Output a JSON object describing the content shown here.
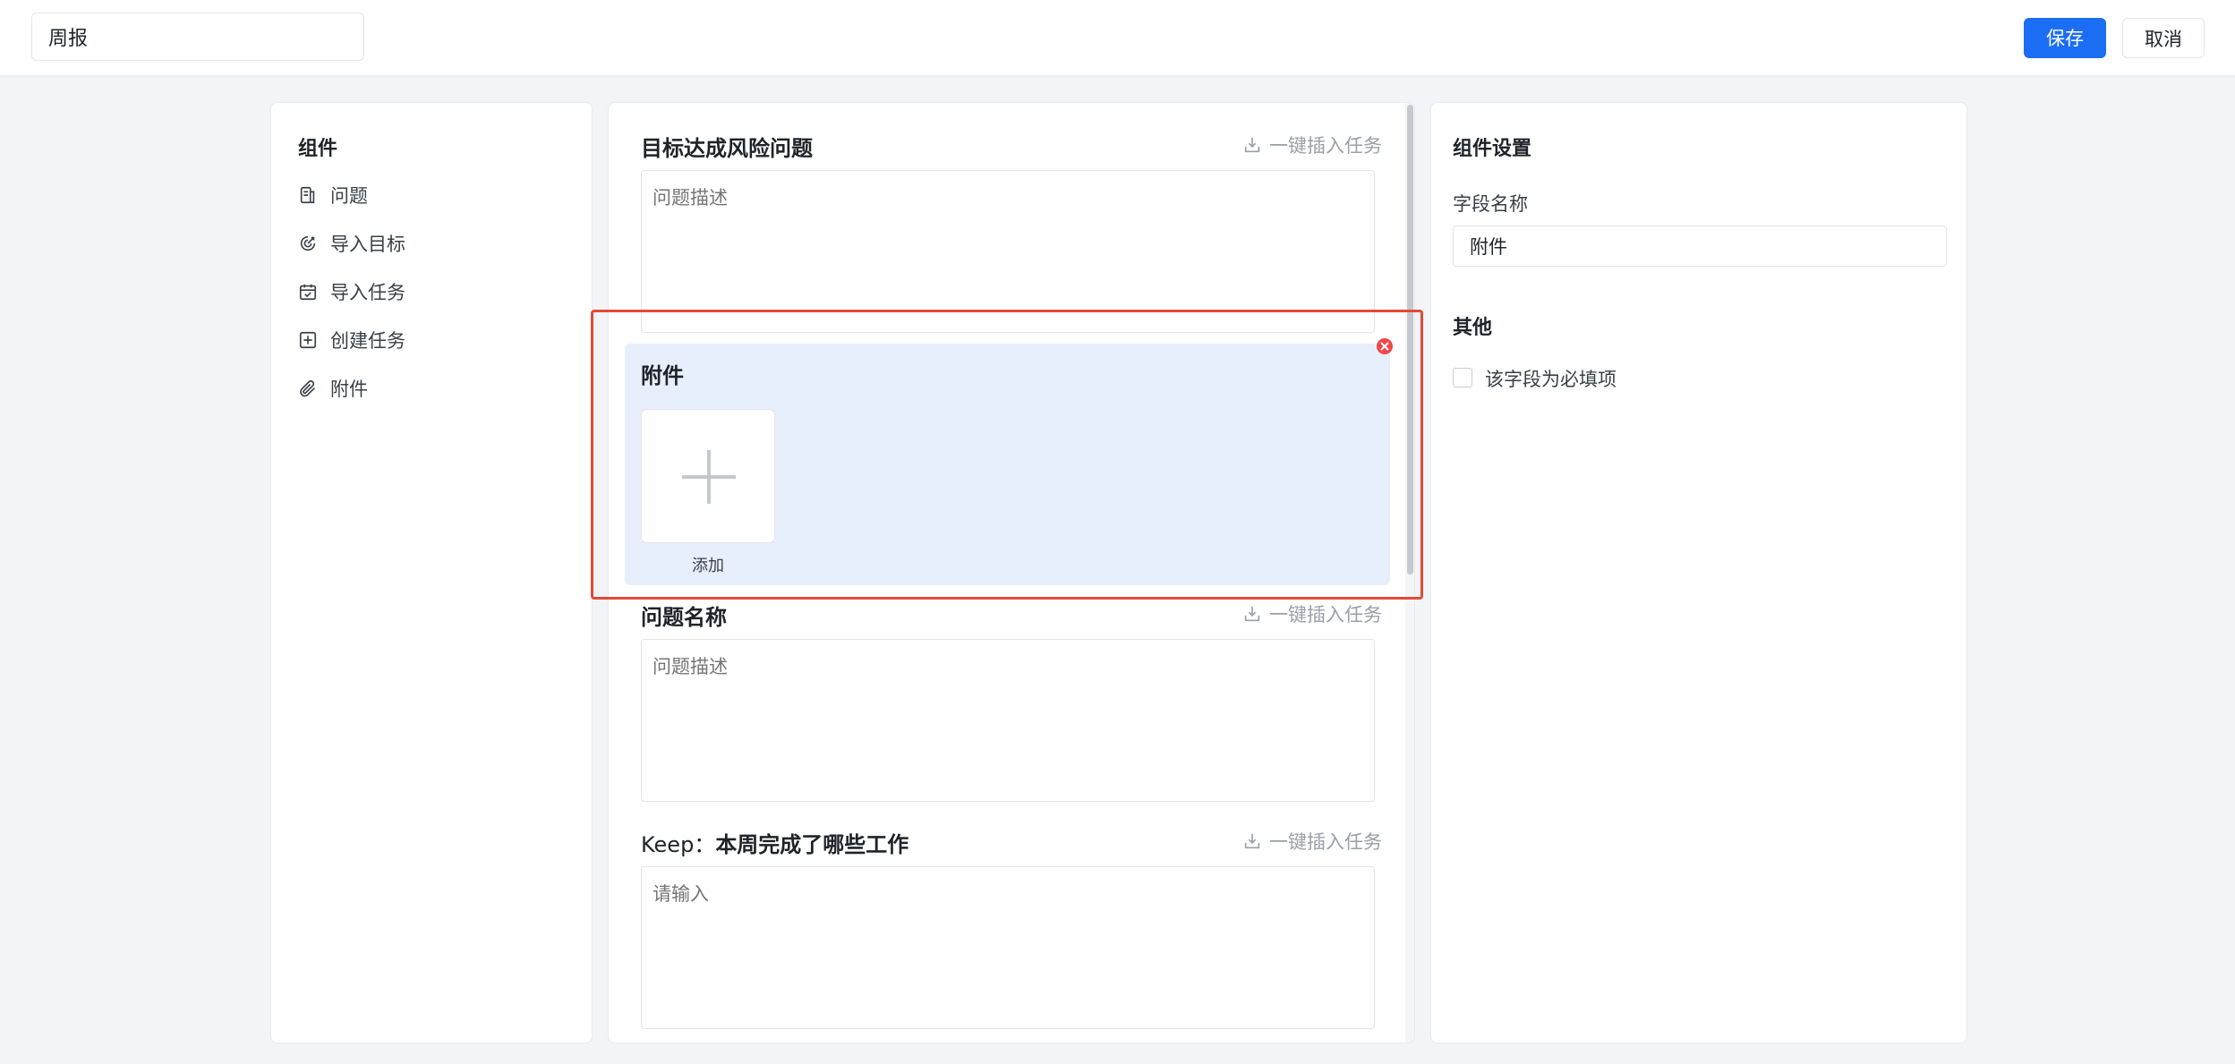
{
  "header": {
    "title_value": "周报",
    "save_label": "保存",
    "cancel_label": "取消"
  },
  "components": {
    "heading": "组件",
    "items": [
      {
        "label": "问题",
        "icon": "document-icon"
      },
      {
        "label": "导入目标",
        "icon": "target-icon"
      },
      {
        "label": "导入任务",
        "icon": "calendar-icon"
      },
      {
        "label": "创建任务",
        "icon": "plus-square-icon"
      },
      {
        "label": "附件",
        "icon": "paperclip-icon"
      }
    ]
  },
  "form": {
    "insert_label": "一键插入任务",
    "fields": [
      {
        "label": "目标达成风险问题",
        "placeholder": "问题描述"
      },
      {
        "label": "问题名称",
        "placeholder": "问题描述"
      },
      {
        "label_prefix": "Keep：",
        "label": "本周完成了哪些工作",
        "placeholder": "请输入"
      }
    ],
    "attachment": {
      "title": "附件",
      "add_label": "添加"
    }
  },
  "settings": {
    "heading": "组件设置",
    "field_name_label": "字段名称",
    "field_name_value": "附件",
    "other_heading": "其他",
    "required_label": "该字段为必填项",
    "required_checked": false
  },
  "colors": {
    "primary": "#1b6ef3",
    "selected_bg": "#e8effc",
    "highlight": "#e34a36",
    "danger": "#f04848"
  }
}
